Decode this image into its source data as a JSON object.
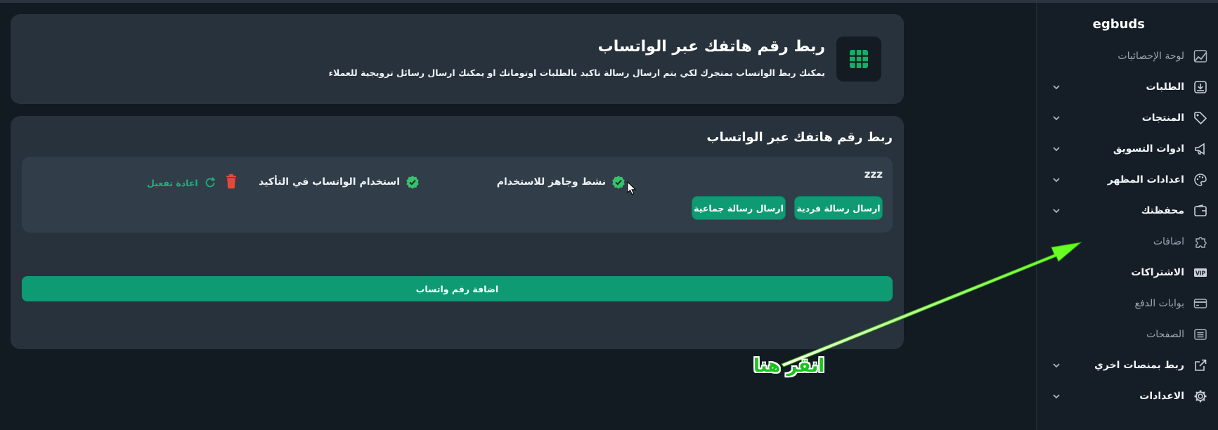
{
  "sidebar": {
    "brand": "egbuds",
    "items": [
      {
        "label": "لوحة الإحصائيات",
        "icon": "chart-icon",
        "chevron": false,
        "style": "dim"
      },
      {
        "label": "الطلبات",
        "icon": "download-box-icon",
        "chevron": true,
        "style": "bold"
      },
      {
        "label": "المنتجات",
        "icon": "tag-icon",
        "chevron": true,
        "style": "bold"
      },
      {
        "label": "ادوات التسويق",
        "icon": "megaphone-icon",
        "chevron": true,
        "style": "bold"
      },
      {
        "label": "اعدادات المظهر",
        "icon": "palette-icon",
        "chevron": true,
        "style": "bold"
      },
      {
        "label": "محفظتك",
        "icon": "wallet-icon",
        "chevron": true,
        "style": "bold"
      },
      {
        "label": "اضافات",
        "icon": "puzzle-icon",
        "chevron": false,
        "style": "dim"
      },
      {
        "label": "الاشتراكات",
        "icon": "vip-icon",
        "chevron": false,
        "style": "bold"
      },
      {
        "label": "بوابات الدفع",
        "icon": "credit-card-icon",
        "chevron": false,
        "style": "dim"
      },
      {
        "label": "الصفحات",
        "icon": "list-icon",
        "chevron": false,
        "style": "dim"
      },
      {
        "label": "ربط بمنصات اخري",
        "icon": "external-link-icon",
        "chevron": true,
        "style": "bold"
      },
      {
        "label": "الاعدادات",
        "icon": "gear-icon",
        "chevron": true,
        "style": "bold"
      }
    ]
  },
  "hero": {
    "title": "ربط رقم هاتفك عبر الواتساب",
    "subtitle": "يمكنك ربط الواتساب بمتجرك لكي يتم ارسال رسالة تاكيد بالطلبات اوتوماتك او يمكنك ارسال رسائل ترويجية للعملاء",
    "icon": "grid-icon"
  },
  "section": {
    "title": "ربط رقم هاتفك عبر الواتساب",
    "account": {
      "name": "zzz",
      "status_active": "نشط وجاهز للاستخدام",
      "status_confirm": "استخدام الواتساب في التأكيد",
      "reactivate": "اعادة تفعيل",
      "send_single": "ارسال رسالة فردية",
      "send_bulk": "ارسال رسالة جماعية"
    },
    "add_button": "اضافة رقم واتساب"
  },
  "annotation": {
    "text": "انقر هنا",
    "color": "#19c21a"
  },
  "colors": {
    "accent": "#0e9a72",
    "background": "#121a22",
    "card": "#27323c",
    "danger": "#e5483a"
  }
}
